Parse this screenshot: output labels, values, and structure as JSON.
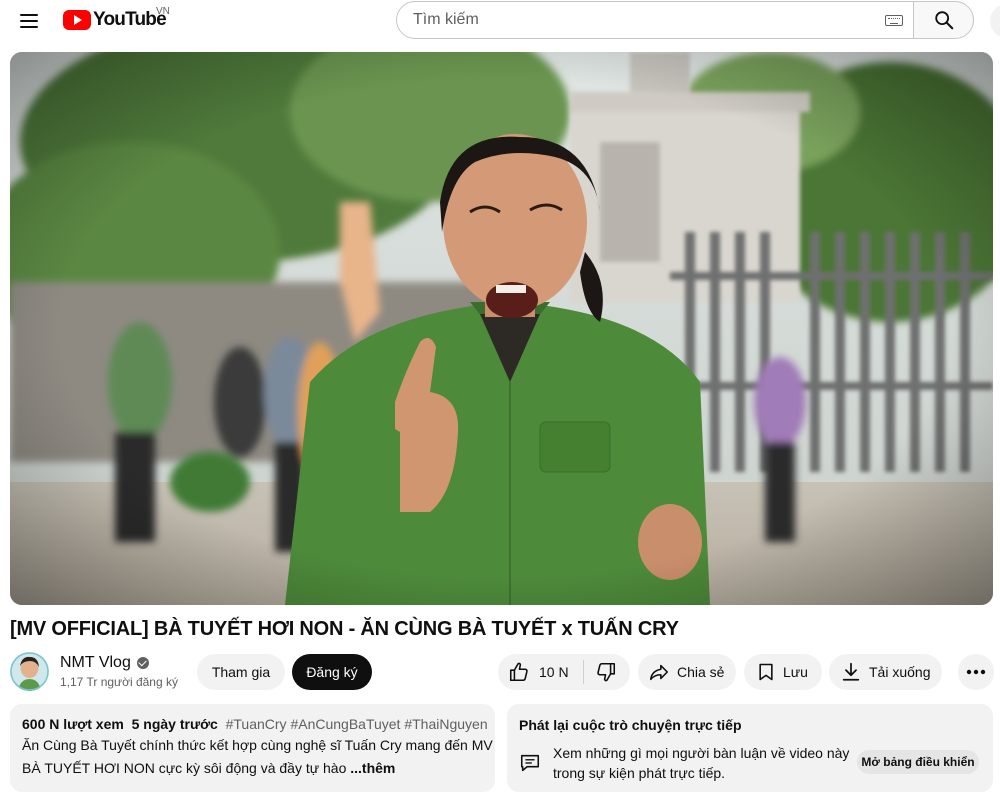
{
  "header": {
    "logo_text": "YouTube",
    "country_code": "VN",
    "search_placeholder": "Tìm kiếm"
  },
  "video": {
    "title": "[MV OFFICIAL] BÀ TUYẾT HƠI NON - ĂN CÙNG BÀ TUYẾT x TUẤN CRY"
  },
  "channel": {
    "name": "NMT Vlog",
    "subscribers": "1,17 Tr người đăng ký",
    "join_label": "Tham gia",
    "subscribe_label": "Đăng ký"
  },
  "actions": {
    "like_count": "10 N",
    "share_label": "Chia sẻ",
    "save_label": "Lưu",
    "download_label": "Tải xuống"
  },
  "description": {
    "views": "600 N lượt xem",
    "age": "5 ngày trước",
    "hashtags": [
      "#TuanCry",
      "#AnCungBaTuyet",
      "#ThaiNguyen"
    ],
    "line1": "Ăn Cùng Bà Tuyết chính thức kết hợp cùng nghệ sĩ Tuấn Cry mang đến MV",
    "line2": "BÀ TUYẾT HƠI NON cực kỳ sôi động và đầy tự hào",
    "more_label": "...thêm"
  },
  "live_chat": {
    "title": "Phát lại cuộc trò chuyện trực tiếp",
    "text_line1": "Xem những gì mọi người bàn luận về video này",
    "text_line2": "trong sự kiện phát trực tiếp.",
    "button_label": "Mở bảng điều khiển"
  },
  "colors": {
    "brand_red": "#ff0000",
    "chip_bg": "#f2f2f2",
    "text_primary": "#0f0f0f",
    "text_secondary": "#606060"
  }
}
